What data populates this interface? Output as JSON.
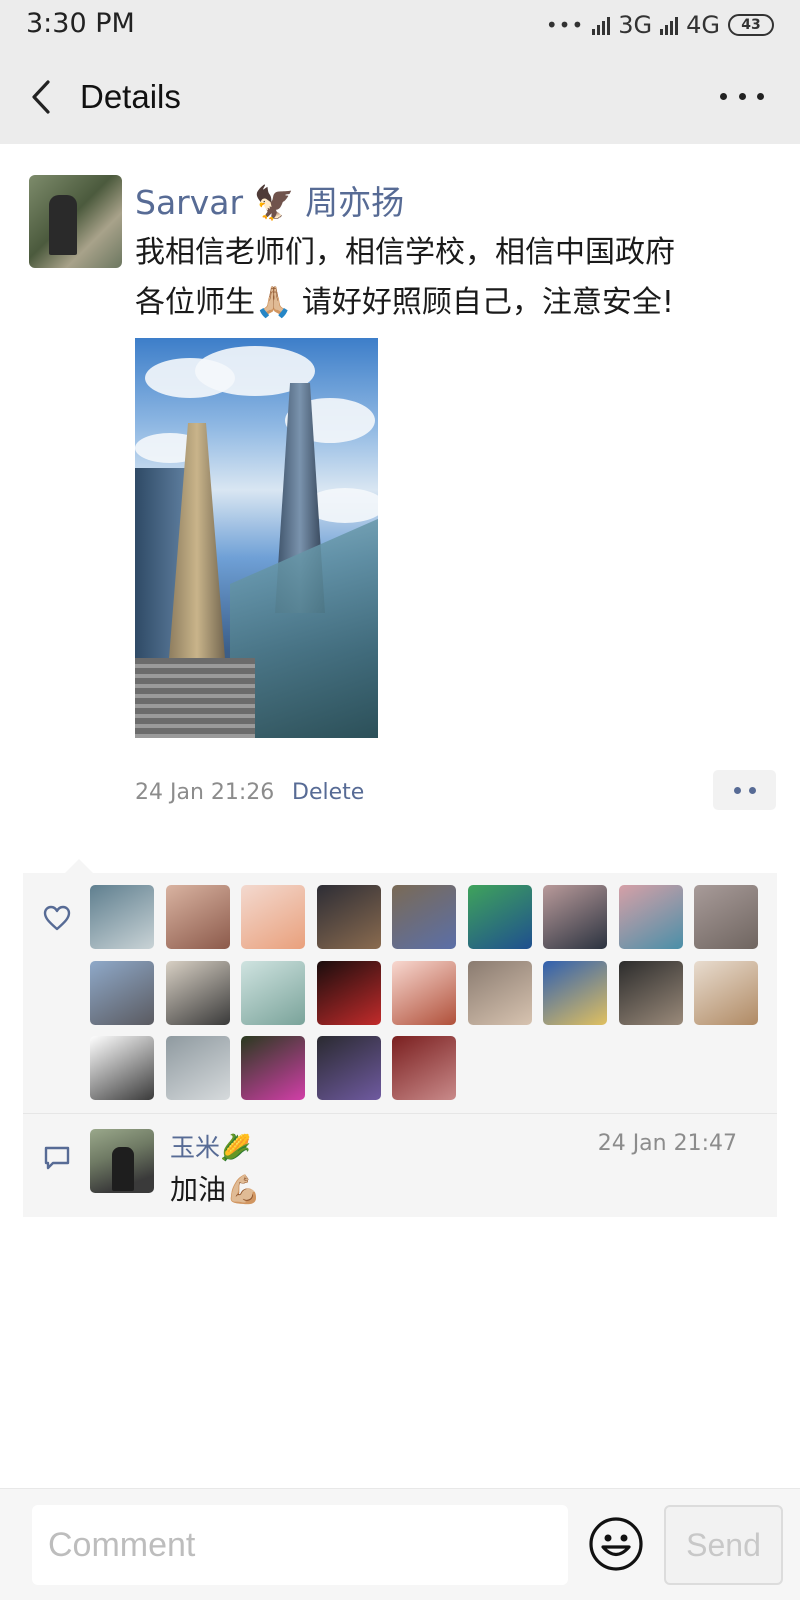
{
  "status_bar": {
    "time": "3:30 PM",
    "dots": "•••",
    "network_1": "3G",
    "network_2": "4G",
    "battery": "43"
  },
  "header": {
    "title": "Details",
    "back_icon": "chevron-left-icon",
    "more_icon": "more-horizontal-icon"
  },
  "post": {
    "author": "Sarvar 🦅 周亦扬",
    "text": "我相信老师们，相信学校，相信中国政府\n各位师生🙏🏼 请好好照顾自己，注意安全!",
    "photo": "skyscrapers-photo",
    "time": "24 Jan 21:26",
    "delete_label": "Delete",
    "action_icon": "more-dots-icon"
  },
  "likes": {
    "icon": "heart-icon",
    "count": 23,
    "avatars": [
      {
        "c1": "#5f7f8f",
        "c2": "#c9d3d6"
      },
      {
        "c1": "#d9b3a1",
        "c2": "#8c5a4b"
      },
      {
        "c1": "#f3d9cf",
        "c2": "#e9a07c"
      },
      {
        "c1": "#2d2d35",
        "c2": "#8a6b4f"
      },
      {
        "c1": "#7a6a55",
        "c2": "#5b6fa8"
      },
      {
        "c1": "#3fa35b",
        "c2": "#1f4f8f"
      },
      {
        "c1": "#b99a9a",
        "c2": "#2b3340"
      },
      {
        "c1": "#d6a0a7",
        "c2": "#4a8fa8"
      },
      {
        "c1": "#a89b99",
        "c2": "#6f6560"
      },
      {
        "c1": "#8fa9c9",
        "c2": "#5a5a60"
      },
      {
        "c1": "#d8d0c4",
        "c2": "#3a3a3a"
      },
      {
        "c1": "#cfe3e0",
        "c2": "#7aa39a"
      },
      {
        "c1": "#1a0d0d",
        "c2": "#c22b2b"
      },
      {
        "c1": "#f8d8d0",
        "c2": "#b0503a"
      },
      {
        "c1": "#8a7b70",
        "c2": "#d7c3b0"
      },
      {
        "c1": "#2f5fb0",
        "c2": "#e0c060"
      },
      {
        "c1": "#2c2c2c",
        "c2": "#9a8a7a"
      },
      {
        "c1": "#e8dccf",
        "c2": "#b08a64"
      },
      {
        "c1": "#ffffff",
        "c2": "#3a3a3a"
      },
      {
        "c1": "#8f9aa0",
        "c2": "#d6dadc"
      },
      {
        "c1": "#2a3a1f",
        "c2": "#d23ea8"
      },
      {
        "c1": "#2a2a30",
        "c2": "#6f5aa0"
      },
      {
        "c1": "#7a1f1f",
        "c2": "#c98a8a"
      }
    ]
  },
  "comments": [
    {
      "icon": "comment-icon",
      "author": "玉米🌽",
      "time": "24 Jan 21:47",
      "text": "加油💪🏼"
    }
  ],
  "composer": {
    "placeholder": "Comment",
    "value": "",
    "emoji_icon": "smiley-icon",
    "send_label": "Send"
  },
  "colors": {
    "link": "#576b95",
    "header_bg": "#ececec",
    "panel_bg": "#f5f5f5",
    "meta_text": "#8c8c8c"
  }
}
